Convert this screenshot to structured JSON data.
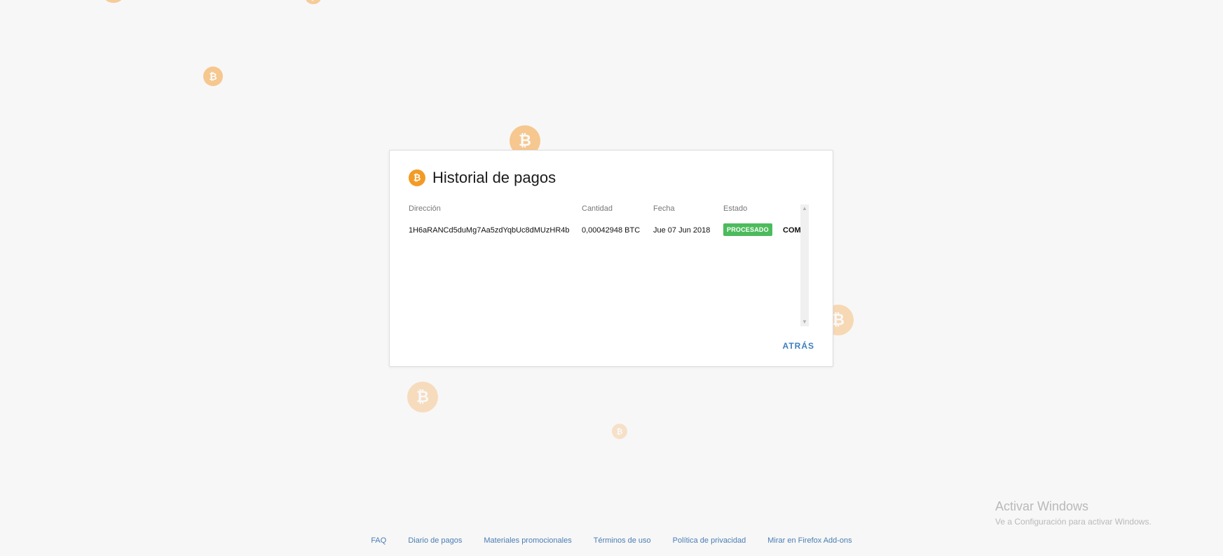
{
  "modal": {
    "title": "Historial de pagos",
    "back_label": "ATRÁS"
  },
  "table": {
    "headers": [
      "Dirección",
      "Cantidad",
      "Fecha",
      "Estado"
    ],
    "rows": [
      {
        "address": "1H6aRANCd5duMg7Aa5zdYqbUc8dMUzHR4b",
        "amount": "0,00042948 BTC",
        "date": "Jue 07 Jun 2018",
        "status": "PROCESADO",
        "extra": "COMP"
      }
    ]
  },
  "footer": {
    "links": [
      "FAQ",
      "Diario de pagos",
      "Materiales promocionales",
      "Términos de uso",
      "Política de privacidad",
      "Mirar en Firefox Add-ons"
    ]
  },
  "watermark": {
    "title": "Activar Windows",
    "subtitle": "Ve a Configuración para activar Windows."
  },
  "icons": {
    "coin_glyph": "₿"
  },
  "colors": {
    "coin": "#f6a03a",
    "badge": "#4cbb5c",
    "link": "#4a7db3",
    "back_button": "#3c7fc0"
  }
}
